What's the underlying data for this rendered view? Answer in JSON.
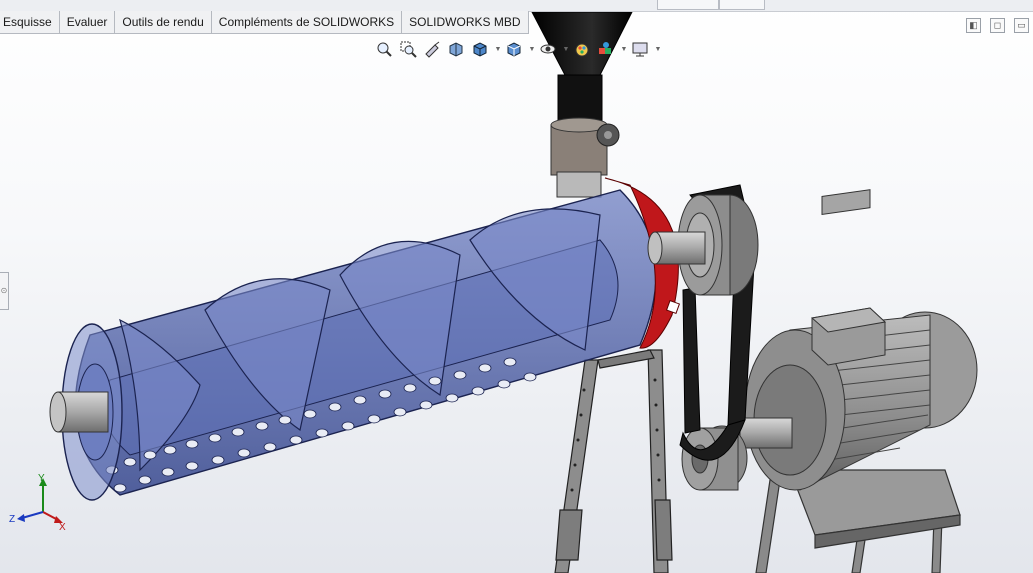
{
  "tabs": [
    "Esquisse",
    "Evaluer",
    "Outils de rendu",
    "Compléments de SOLIDWORKS",
    "SOLIDWORKS MBD"
  ],
  "headsup_toolbar": [
    {
      "icon": "zoom-to-fit-icon"
    },
    {
      "icon": "zoom-to-area-icon"
    },
    {
      "icon": "previous-view-icon"
    },
    {
      "icon": "section-view-icon"
    },
    {
      "icon": "view-orientation-icon",
      "dropdown": true
    },
    {
      "icon": "display-style-icon",
      "dropdown": true
    },
    {
      "icon": "hide-show-items-icon",
      "dropdown": true
    },
    {
      "icon": "edit-appearance-icon"
    },
    {
      "icon": "apply-scene-icon",
      "dropdown": true
    },
    {
      "icon": "view-settings-icon",
      "dropdown": true
    }
  ],
  "window_controls": [
    "restore-icon",
    "new-window-icon",
    "tile-icon"
  ],
  "triad": {
    "x": "X",
    "y": "Y",
    "z": "Z"
  },
  "colors": {
    "barrel": "#4a5fa8",
    "flange": "#c0171b",
    "belt": "#1a1a1a",
    "motor": "#8a8a8a",
    "hopper": "#111111"
  }
}
